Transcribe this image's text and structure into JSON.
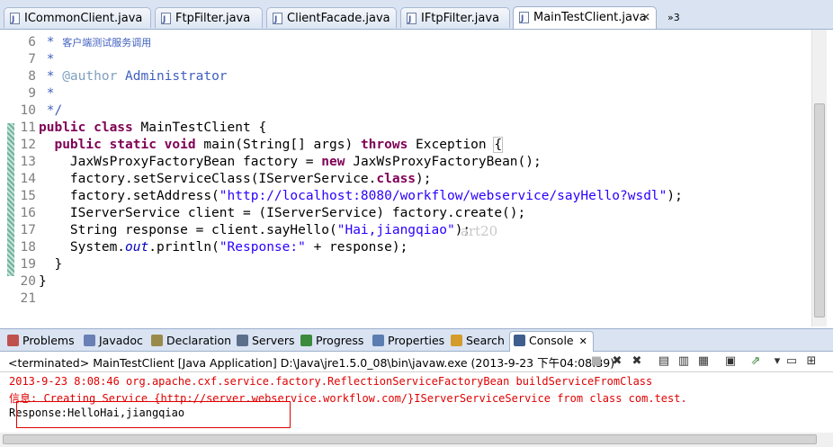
{
  "editor_tabs": [
    {
      "label": "ICommonClient.java"
    },
    {
      "label": "FtpFilter.java"
    },
    {
      "label": "ClientFacade.java"
    },
    {
      "label": "IFtpFilter.java"
    },
    {
      "label": "MainTestClient.java",
      "active": true,
      "close": "✕"
    }
  ],
  "tab_overflow": "»3",
  "code": {
    "line_numbers": [
      "6",
      "7",
      "8",
      "9",
      "10",
      "11",
      "12",
      "13",
      "14",
      "15",
      "16",
      "17",
      "18",
      "19",
      "20",
      "21"
    ],
    "l6_star": " * ",
    "l6_comment": "客户端测试服务调用",
    "l7": " *",
    "l8_star": " * ",
    "l8_tag": "@author",
    "l8_name": " Administrator",
    "l9": " *",
    "l10": " */",
    "l11_kw": "public class",
    "l11_rest": " MainTestClient {",
    "l12_indent": "  ",
    "l12_kw1": "public static void",
    "l12_mid": " main(String[] args) ",
    "l12_kw2": "throws",
    "l12_rest": " Exception ",
    "l12_brace": "{",
    "l13_a": "    JaxWsProxyFactoryBean factory = ",
    "l13_kw": "new",
    "l13_b": " JaxWsProxyFactoryBean();",
    "l14_a": "    factory.setServiceClass(IServerService.",
    "l14_kw": "class",
    "l14_b": ");",
    "l15_a": "    factory.setAddress(",
    "l15_str": "\"http://localhost:8080/workflow/webservice/sayHello?wsdl\"",
    "l15_b": ");",
    "l16": "    IServerService client = (IServerService) factory.create();",
    "l17_a": "    String response = client.sayHello(",
    "l17_str": "\"Hai,jiangqiao\"",
    "l17_b": ");",
    "l18_a": "    System.",
    "l18_out": "out",
    "l18_b": ".println(",
    "l18_str": "\"Response:\"",
    "l18_c": " + response);",
    "l19": "  }",
    "l20": "}",
    "l21": ""
  },
  "watermark": "art20",
  "view_tabs": [
    {
      "label": "Problems",
      "icon": "problems-icon",
      "color": "#c0504d"
    },
    {
      "label": "Javadoc",
      "icon": "javadoc-icon",
      "color": "#6a7fb5"
    },
    {
      "label": "Declaration",
      "icon": "declaration-icon",
      "color": "#9a8a4a"
    },
    {
      "label": "Servers",
      "icon": "servers-icon",
      "color": "#5c6f8a"
    },
    {
      "label": "Progress",
      "icon": "progress-icon",
      "color": "#3c8a3c"
    },
    {
      "label": "Properties",
      "icon": "properties-icon",
      "color": "#5b7db1"
    },
    {
      "label": "Search",
      "icon": "search-icon",
      "color": "#d39c2b"
    },
    {
      "label": "Console",
      "icon": "console-icon",
      "color": "#3e5e8e",
      "active": true,
      "close": "✕"
    }
  ],
  "console_info": "<terminated> MainTestClient [Java Application] D:\\Java\\jre1.5.0_08\\bin\\javaw.exe (2013-9-23 下午04:08:39)",
  "console_toolbar": [
    "terminate-icon",
    "remove-launch-icon",
    "remove-all-icon",
    "copy-icon",
    "scroll-lock-icon",
    "word-wrap-icon",
    "pin-icon",
    "display-console-icon",
    "open-console-icon"
  ],
  "console_lines": {
    "line1": "2013-9-23 8:08:46 org.apache.cxf.service.factory.ReflectionServiceFactoryBean buildServiceFromClass",
    "line2": "信息: Creating Service {http://server.webservice.workflow.com/}IServerServiceService from class com.test.",
    "line3": "Response:HelloHai,jiangqiao"
  },
  "colors": {
    "keyword": "#7f0055",
    "string": "#2a00ff",
    "comment": "#3f5fbf",
    "error_text": "#e00000"
  }
}
